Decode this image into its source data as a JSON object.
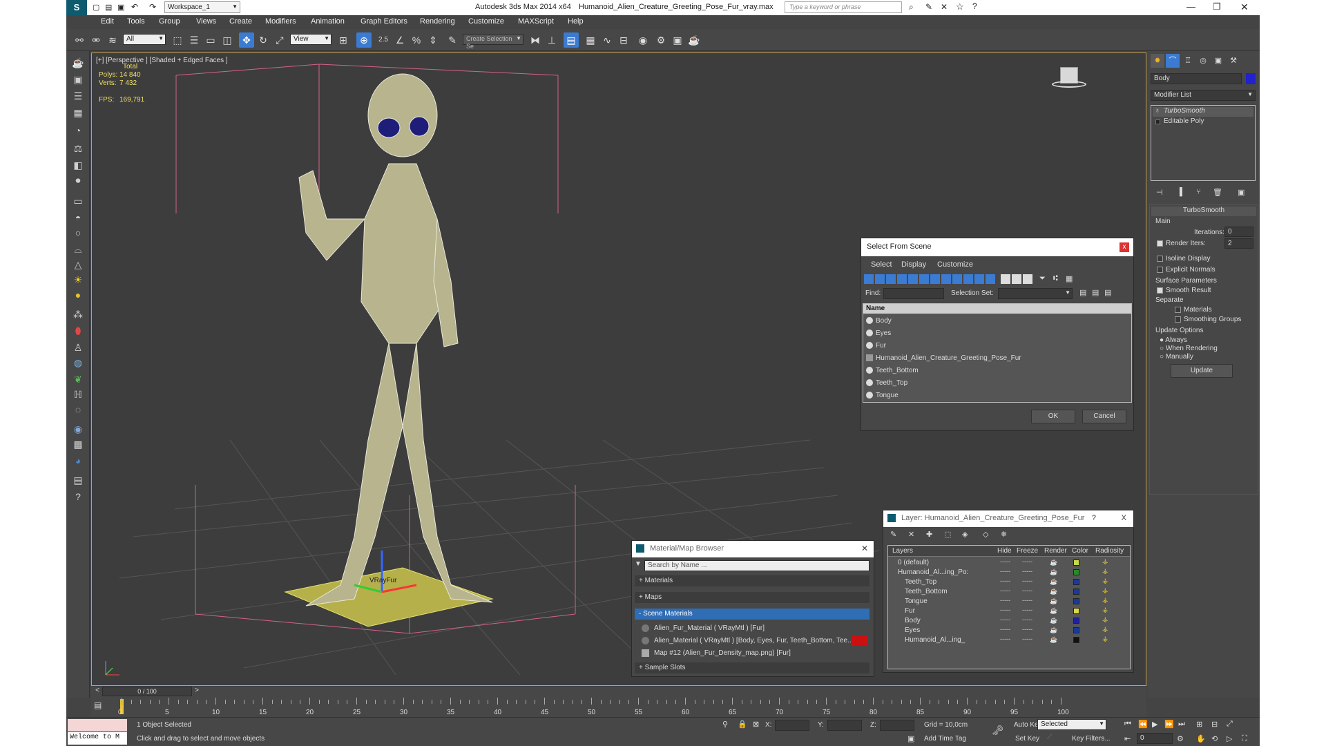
{
  "window": {
    "workspace": "Workspace_1",
    "app_title": "Autodesk 3ds Max  2014 x64",
    "file_name": "Humanoid_Alien_Creature_Greeting_Pose_Fur_vray.max",
    "search_placeholder": "Type a keyword or phrase"
  },
  "menu": [
    "Edit",
    "Tools",
    "Group",
    "Views",
    "Create",
    "Modifiers",
    "Animation",
    "Graph Editors",
    "Rendering",
    "Customize",
    "MAXScript",
    "Help"
  ],
  "toolbar": {
    "filter_value": "All",
    "refcoord_value": "View",
    "snap_label": "2.5",
    "named_selection_placeholder": "Create Selection Se"
  },
  "viewport": {
    "label": "[+] [Perspective ] [Shaded + Edged Faces ]",
    "stats": {
      "total_label": "Total",
      "polys_label": "Polys:",
      "polys_value": "14 840",
      "verts_label": "Verts:",
      "verts_value": "7 432",
      "fps_label": "FPS:",
      "fps_value": "169,791"
    },
    "vrayfur_label": "VRayFur"
  },
  "command_panel": {
    "object_name": "Body",
    "modifier_list_label": "Modifier List",
    "stack": [
      "TurboSmooth",
      "Editable Poly"
    ],
    "rollout_title": "TurboSmooth",
    "main_group": "Main",
    "iterations_label": "Iterations:",
    "iterations_value": "0",
    "render_iters_label": "Render Iters:",
    "render_iters_value": "2",
    "isoline_label": "Isoline Display",
    "explicit_normals_label": "Explicit Normals",
    "surface_group": "Surface Parameters",
    "smooth_result_label": "Smooth Result",
    "separate_label": "Separate",
    "materials_label": "Materials",
    "smoothing_groups_label": "Smoothing Groups",
    "update_group": "Update Options",
    "always_label": "Always",
    "when_rendering_label": "When Rendering",
    "manually_label": "Manually",
    "update_button": "Update"
  },
  "select_from_scene": {
    "title": "Select From Scene",
    "close": "x",
    "menu": [
      "Select",
      "Display",
      "Customize"
    ],
    "find_label": "Find:",
    "selection_set_label": "Selection Set:",
    "name_header": "Name",
    "items": [
      "Body",
      "Eyes",
      "Fur",
      "Humanoid_Alien_Creature_Greeting_Pose_Fur",
      "Teeth_Bottom",
      "Teeth_Top",
      "Tongue"
    ],
    "ok": "OK",
    "cancel": "Cancel"
  },
  "material_browser": {
    "title": "Material/Map Browser",
    "search_placeholder": "Search by Name ...",
    "sections": {
      "materials": "+ Materials",
      "maps": "+ Maps",
      "scene_materials": "- Scene Materials",
      "sample_slots": "+ Sample Slots"
    },
    "scene_items": [
      "Alien_Fur_Material  ( VRayMtl ) [Fur]",
      "Alien_Material  ( VRayMtl ) [Body, Eyes, Fur, Teeth_Bottom, Tee...",
      "Map #12 (Alien_Fur_Density_map.png) [Fur]"
    ]
  },
  "layer_dialog": {
    "title": "Layer: Humanoid_Alien_Creature_Greeting_Pose_Fur",
    "help": "?",
    "close": "X",
    "headers": [
      "Layers",
      "Hide",
      "Freeze",
      "Render",
      "Color",
      "Radiosity"
    ],
    "rows": [
      {
        "name": "0 (default)",
        "color": "#c8d84a"
      },
      {
        "name": "Humanoid_Al...ing_Po:",
        "color": "#2a8a2a"
      },
      {
        "name": "Teeth_Top",
        "color": "#1a3a9a"
      },
      {
        "name": "Teeth_Bottom",
        "color": "#1a3a9a"
      },
      {
        "name": "Tongue",
        "color": "#1a3a9a"
      },
      {
        "name": "Fur",
        "color": "#d8d84a"
      },
      {
        "name": "Body",
        "color": "#2020a0"
      },
      {
        "name": "Eyes",
        "color": "#1a3a9a"
      },
      {
        "name": "Humanoid_Al...ing_",
        "color": "#111111"
      }
    ],
    "dots": "-----"
  },
  "timeline": {
    "frame_counter": "0 / 100",
    "prev": "<",
    "next": ">",
    "ticks": [
      "0",
      "5",
      "10",
      "15",
      "20",
      "25",
      "30",
      "35",
      "40",
      "45",
      "50",
      "55",
      "60",
      "65",
      "70",
      "75",
      "80",
      "85",
      "90",
      "95",
      "100"
    ]
  },
  "status": {
    "maxscript_listener": "Welcome to M",
    "selection_status": "1 Object Selected",
    "prompt": "Click and drag to select and move objects",
    "x_label": "X:",
    "y_label": "Y:",
    "z_label": "Z:",
    "grid": "Grid = 10,0cm",
    "add_time_tag": "Add Time Tag",
    "auto_key": "Auto Key",
    "selected_dropdown": "Selected",
    "set_key": "Set Key",
    "key_filters": "Key Filters...",
    "frame_value": "0"
  }
}
